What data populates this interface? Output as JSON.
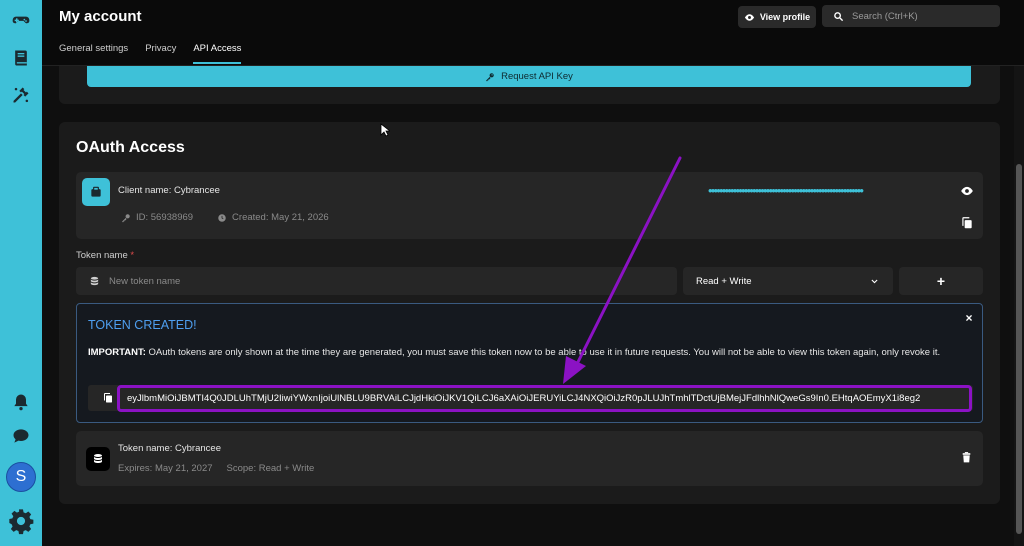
{
  "header": {
    "title": "My account",
    "view_profile_label": "View profile",
    "search_placeholder": "Search (Ctrl+K)"
  },
  "tabs": [
    {
      "label": "General settings",
      "active": false
    },
    {
      "label": "Privacy",
      "active": false
    },
    {
      "label": "API Access",
      "active": true
    }
  ],
  "rail": {
    "items": [
      "gamepad-icon",
      "book-icon",
      "tools-icon",
      "bell-icon",
      "chat-icon",
      "settings-gear-icon"
    ],
    "avatar_letter": "S"
  },
  "api_key": {
    "request_label": "Request API Key"
  },
  "oauth": {
    "title": "OAuth Access",
    "client": {
      "name": "Client name: Cybrancee",
      "id": "ID: 56938969",
      "created": "Created: May 21, 2026",
      "masked_secret": "••••••••••••••••••••••••••••••••••••••••••••••••••••••••"
    },
    "token_name_label": "Token name",
    "required_mark": "*",
    "token_name_placeholder": "New token name",
    "scope_selected": "Read + Write",
    "add_label": "+",
    "created": {
      "title": "TOKEN CREATED!",
      "important_label": "IMPORTANT:",
      "important_text": " OAuth tokens are only shown at the time they are generated, you must save this token now to be able to use it in future requests. You will not be able to view this token again, only revoke it.",
      "token_value": "eyJlbmMiOiJBMTI4Q0JDLUhTMjU2IiwiYWxnIjoiUlNBLU9BRVAiLCJjdHkiOiJKV1QiLCJ6aXAiOiJERUYiLCJ4NXQiOiJzR0pJLUJhTmhlTDctUjBMejJFdlhhNlQweGs9In0.EHtqAOEmyX1i8eg2",
      "close_label": "×"
    },
    "token_item": {
      "name": "Token name: Cybrancee",
      "expires": "Expires: May 21, 2027",
      "scope": "Scope: Read + Write"
    }
  },
  "colors": {
    "accent": "#3ec1d8",
    "annotation": "#8b12c4",
    "created_title": "#4e9ff0"
  }
}
